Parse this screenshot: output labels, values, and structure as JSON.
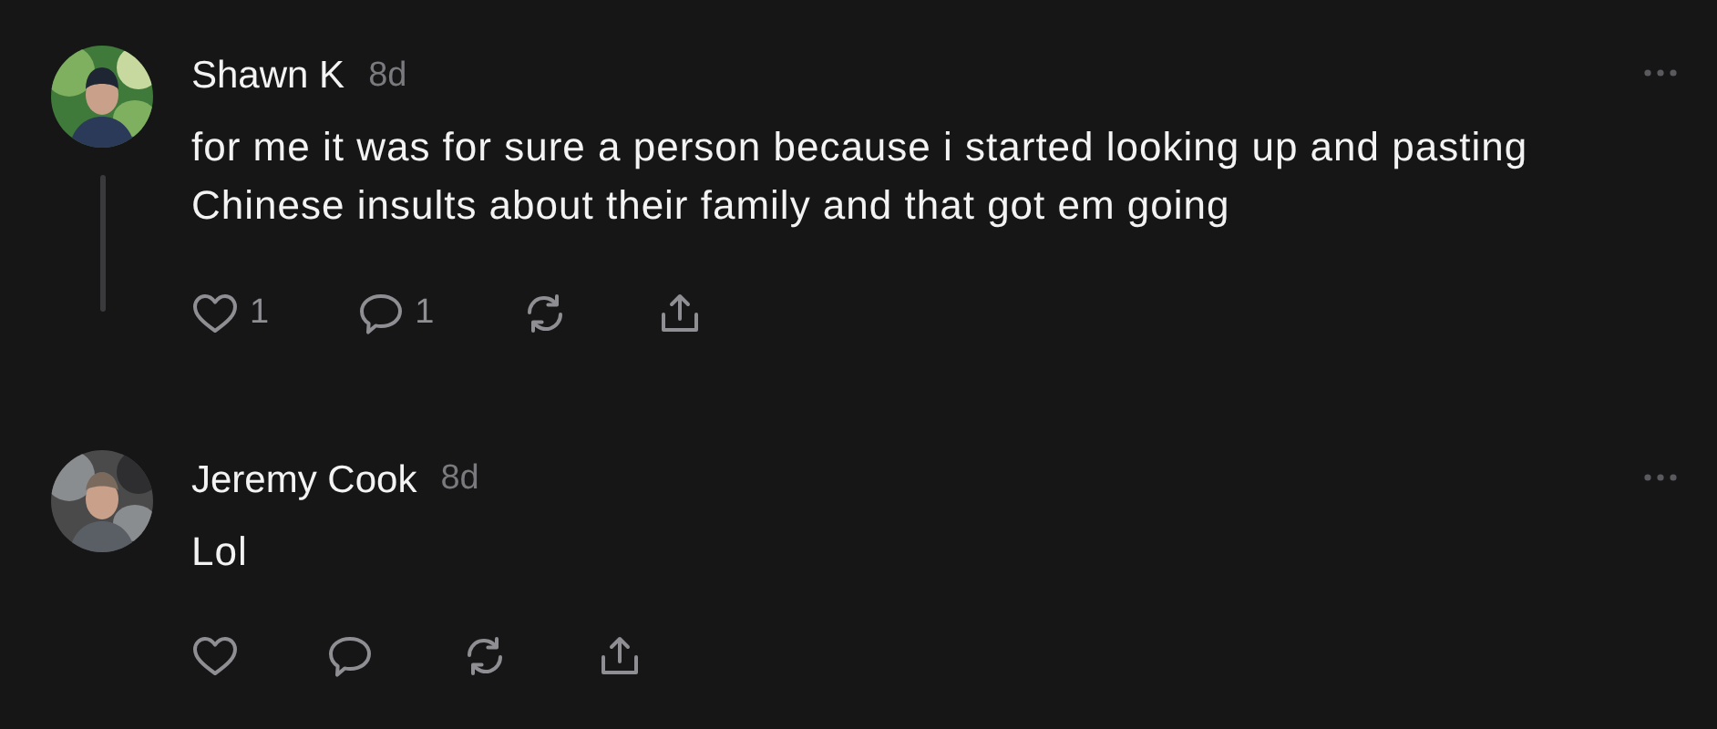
{
  "posts": [
    {
      "author": "Shawn K",
      "time": "8d",
      "text": "for me it was for sure a person because i started looking up and pasting Chinese insults about their family and that got em going",
      "thread_line": true,
      "actions": [
        {
          "kind": "like",
          "count": "1"
        },
        {
          "kind": "reply",
          "count": "1"
        },
        {
          "kind": "repost"
        },
        {
          "kind": "share"
        }
      ]
    },
    {
      "author": "Jeremy Cook",
      "time": "8d",
      "text": "Lol",
      "thread_line": false,
      "actions": [
        {
          "kind": "like"
        },
        {
          "kind": "reply"
        },
        {
          "kind": "repost"
        },
        {
          "kind": "share"
        }
      ]
    }
  ]
}
